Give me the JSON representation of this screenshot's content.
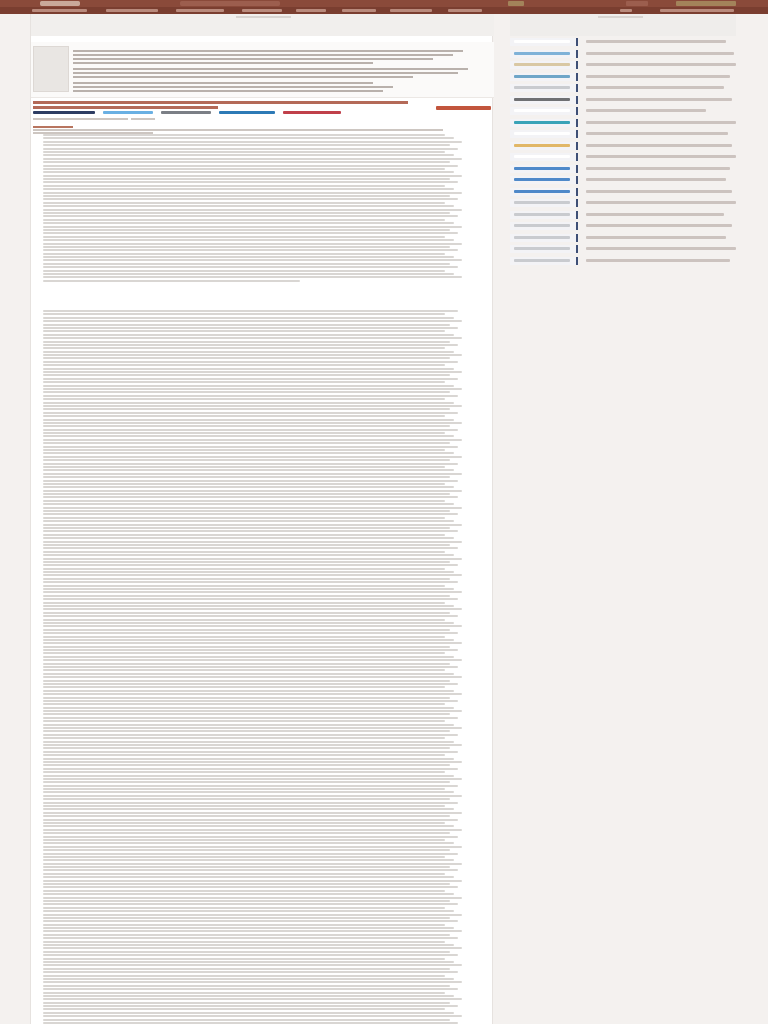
{
  "header": {
    "logo_text": "",
    "search_placeholder": "",
    "buttons": [
      "",
      "",
      ""
    ]
  },
  "nav": {
    "items": [
      "",
      "",
      "",
      "",
      "",
      "",
      "",
      "",
      "",
      ""
    ]
  },
  "breadcrumb": [
    "",
    "",
    "",
    ""
  ],
  "document": {
    "title": "",
    "subtitle": "",
    "download_label": "",
    "actions": [
      "",
      "",
      "",
      "",
      ""
    ]
  },
  "sidebar": {
    "ad_label": "",
    "items": [
      {
        "title": "",
        "thumb_color": "#ffffff"
      },
      {
        "title": "",
        "thumb_color": "#7fb2d8"
      },
      {
        "title": "",
        "thumb_color": "#d9c8a4"
      },
      {
        "title": "",
        "thumb_color": "#6fa6c8"
      },
      {
        "title": "",
        "thumb_color": "#c9cbcf"
      },
      {
        "title": "",
        "thumb_color": "#6f7073"
      },
      {
        "title": "",
        "thumb_color": "#ffffff"
      },
      {
        "title": "",
        "thumb_color": "#3aa3b7"
      },
      {
        "title": "",
        "thumb_color": "#ffffff"
      },
      {
        "title": "",
        "thumb_color": "#e1b768"
      },
      {
        "title": "",
        "thumb_color": "#ffffff"
      },
      {
        "title": "",
        "thumb_color": "#4f89c9"
      },
      {
        "title": "",
        "thumb_color": "#4f89c9"
      },
      {
        "title": "",
        "thumb_color": "#4f89c9"
      },
      {
        "title": "",
        "thumb_color": "#c9cbcf"
      },
      {
        "title": "",
        "thumb_color": "#c9cbcf"
      },
      {
        "title": "",
        "thumb_color": "#c9cbcf"
      },
      {
        "title": "",
        "thumb_color": "#c9cbcf"
      },
      {
        "title": "",
        "thumb_color": "#c9cbcf"
      },
      {
        "title": "",
        "thumb_color": "#c9cbcf"
      }
    ]
  },
  "colors": {
    "header_bg": "#8a4a3a",
    "nav_bg": "#7a3e30",
    "accent": "#c2553d",
    "sidebar_accent": "#3e4f76"
  }
}
